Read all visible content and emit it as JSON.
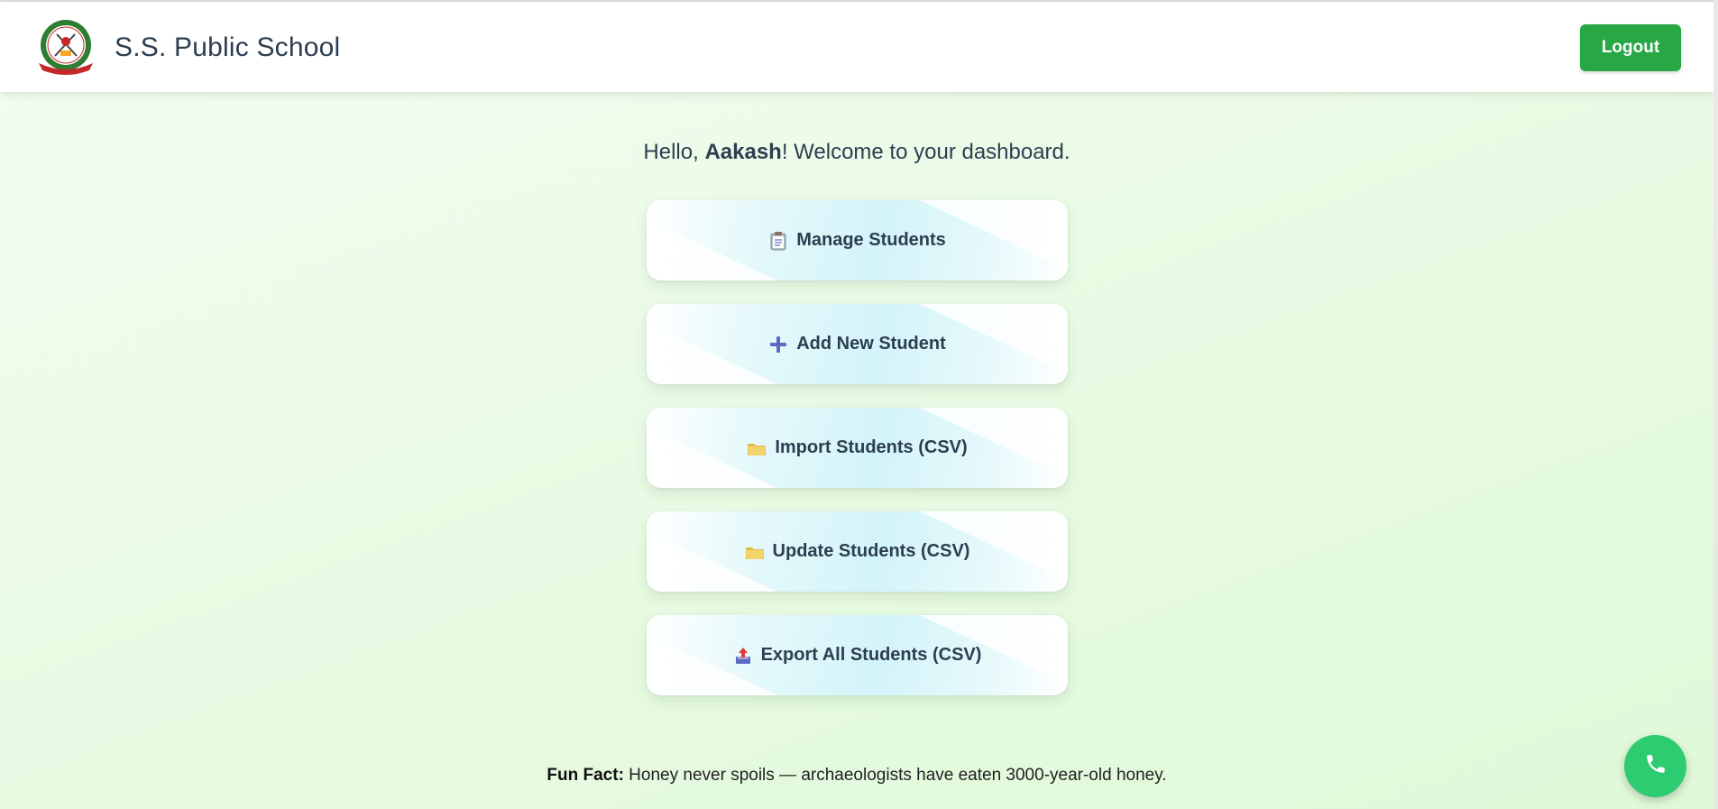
{
  "header": {
    "school_name": "S.S. Public School",
    "logout_label": "Logout",
    "logo_icon": "school-crest-icon"
  },
  "greeting": {
    "prefix": "Hello, ",
    "name": "Aakash",
    "suffix": "! Welcome to your dashboard."
  },
  "actions": [
    {
      "label": "Manage Students",
      "icon": "clipboard-icon"
    },
    {
      "label": "Add New Student",
      "icon": "plus-icon"
    },
    {
      "label": "Import Students (CSV)",
      "icon": "folder-icon"
    },
    {
      "label": "Update Students (CSV)",
      "icon": "folder-icon"
    },
    {
      "label": "Export All Students (CSV)",
      "icon": "outbox-tray-icon"
    }
  ],
  "fun_fact": {
    "label": "Fun Fact:",
    "text": " Honey never spoils — archaeologists have eaten 3000-year-old honey."
  },
  "call_button": {
    "icon": "phone-icon"
  },
  "colors": {
    "accent_green": "#28a745",
    "call_green": "#2ecc71",
    "text_dark": "#2c3e50"
  }
}
